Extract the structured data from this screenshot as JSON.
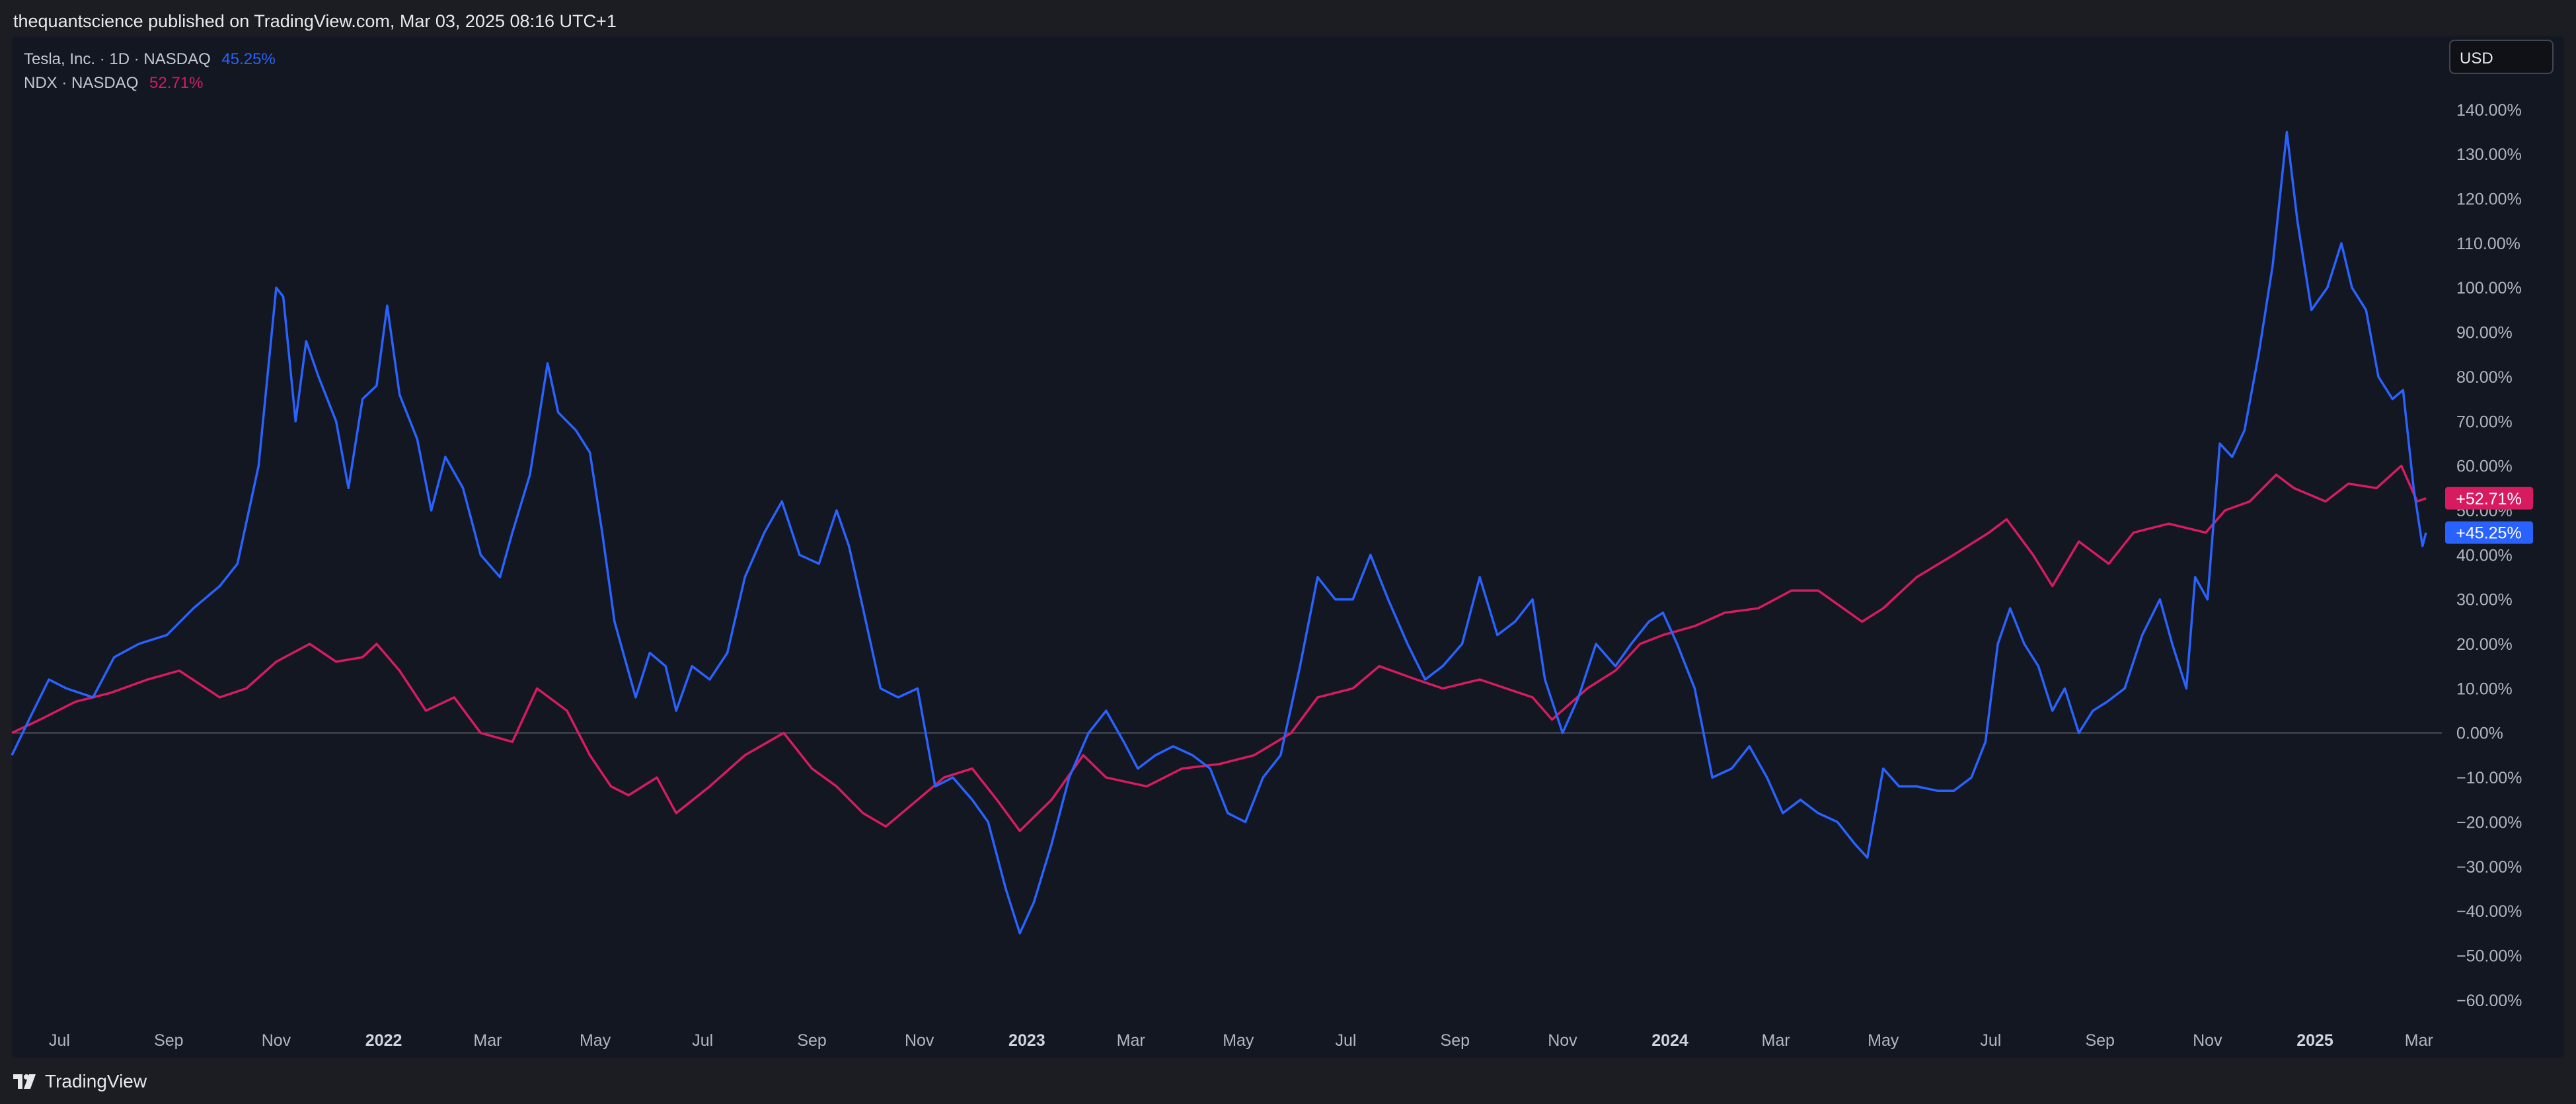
{
  "header": {
    "published": "thequantscience published on TradingView.com, Mar 03, 2025 08:16 UTC+1"
  },
  "legend": [
    {
      "name": "Tesla, Inc. · 1D · NASDAQ",
      "value": "45.25%",
      "color": "#2962ff"
    },
    {
      "name": "NDX · NASDAQ",
      "value": "52.71%",
      "color": "#d81b60"
    }
  ],
  "currency_button": "USD",
  "footer": {
    "brand": "TradingView"
  },
  "chart_data": {
    "type": "line",
    "title": "",
    "xlabel": "",
    "ylabel": "",
    "y_unit": "%",
    "ylim": [
      -67,
      152
    ],
    "xlim": [
      "2021-06-04",
      "2025-03-14"
    ],
    "grid": false,
    "legend_position": "top-left",
    "y_ticks": [
      140,
      130,
      120,
      110,
      100,
      90,
      80,
      70,
      60,
      50,
      40,
      30,
      20,
      10,
      0,
      -10,
      -20,
      -30,
      -40,
      -50,
      -60
    ],
    "y_tick_labels": [
      "140.00%",
      "130.00%",
      "120.00%",
      "110.00%",
      "100.00%",
      "90.00%",
      "80.00%",
      "70.00%",
      "60.00%",
      "50.00%",
      "40.00%",
      "30.00%",
      "20.00%",
      "10.00%",
      "0.00%",
      "−10.00%",
      "−20.00%",
      "−30.00%",
      "−40.00%",
      "−50.00%",
      "−60.00%"
    ],
    "x_ticks": [
      {
        "label": "Jul",
        "date": "2021-07-01",
        "bold": false
      },
      {
        "label": "Sep",
        "date": "2021-09-01",
        "bold": false
      },
      {
        "label": "Nov",
        "date": "2021-11-01",
        "bold": false
      },
      {
        "label": "2022",
        "date": "2022-01-01",
        "bold": true
      },
      {
        "label": "Mar",
        "date": "2022-03-01",
        "bold": false
      },
      {
        "label": "May",
        "date": "2022-05-01",
        "bold": false
      },
      {
        "label": "Jul",
        "date": "2022-07-01",
        "bold": false
      },
      {
        "label": "Sep",
        "date": "2022-09-01",
        "bold": false
      },
      {
        "label": "Nov",
        "date": "2022-11-01",
        "bold": false
      },
      {
        "label": "2023",
        "date": "2023-01-01",
        "bold": true
      },
      {
        "label": "Mar",
        "date": "2023-03-01",
        "bold": false
      },
      {
        "label": "May",
        "date": "2023-05-01",
        "bold": false
      },
      {
        "label": "Jul",
        "date": "2023-07-01",
        "bold": false
      },
      {
        "label": "Sep",
        "date": "2023-09-01",
        "bold": false
      },
      {
        "label": "Nov",
        "date": "2023-11-01",
        "bold": false
      },
      {
        "label": "2024",
        "date": "2024-01-01",
        "bold": true
      },
      {
        "label": "Mar",
        "date": "2024-03-01",
        "bold": false
      },
      {
        "label": "May",
        "date": "2024-05-01",
        "bold": false
      },
      {
        "label": "Jul",
        "date": "2024-07-01",
        "bold": false
      },
      {
        "label": "Sep",
        "date": "2024-09-01",
        "bold": false
      },
      {
        "label": "Nov",
        "date": "2024-11-01",
        "bold": false
      },
      {
        "label": "2025",
        "date": "2025-01-01",
        "bold": true
      },
      {
        "label": "Mar",
        "date": "2025-03-01",
        "bold": false
      }
    ],
    "baseline": 0,
    "series": [
      {
        "name": "Tesla, Inc. · 1D · NASDAQ",
        "color": "#2962ff",
        "last_label": "+45.25%",
        "points": [
          [
            "2021-06-04",
            -5
          ],
          [
            "2021-06-15",
            4
          ],
          [
            "2021-06-25",
            12
          ],
          [
            "2021-07-05",
            10
          ],
          [
            "2021-07-20",
            8
          ],
          [
            "2021-08-01",
            17
          ],
          [
            "2021-08-15",
            20
          ],
          [
            "2021-08-31",
            22
          ],
          [
            "2021-09-15",
            28
          ],
          [
            "2021-09-30",
            33
          ],
          [
            "2021-10-10",
            38
          ],
          [
            "2021-10-22",
            60
          ],
          [
            "2021-11-01",
            100
          ],
          [
            "2021-11-05",
            98
          ],
          [
            "2021-11-12",
            70
          ],
          [
            "2021-11-18",
            88
          ],
          [
            "2021-11-25",
            80
          ],
          [
            "2021-12-05",
            70
          ],
          [
            "2021-12-12",
            55
          ],
          [
            "2021-12-20",
            75
          ],
          [
            "2021-12-28",
            78
          ],
          [
            "2022-01-03",
            96
          ],
          [
            "2022-01-10",
            76
          ],
          [
            "2022-01-20",
            66
          ],
          [
            "2022-01-28",
            50
          ],
          [
            "2022-02-05",
            62
          ],
          [
            "2022-02-15",
            55
          ],
          [
            "2022-02-25",
            40
          ],
          [
            "2022-03-08",
            35
          ],
          [
            "2022-03-15",
            45
          ],
          [
            "2022-03-25",
            58
          ],
          [
            "2022-04-04",
            83
          ],
          [
            "2022-04-10",
            72
          ],
          [
            "2022-04-20",
            68
          ],
          [
            "2022-04-28",
            63
          ],
          [
            "2022-05-05",
            45
          ],
          [
            "2022-05-12",
            25
          ],
          [
            "2022-05-24",
            8
          ],
          [
            "2022-06-01",
            18
          ],
          [
            "2022-06-10",
            15
          ],
          [
            "2022-06-16",
            5
          ],
          [
            "2022-06-25",
            15
          ],
          [
            "2022-07-05",
            12
          ],
          [
            "2022-07-15",
            18
          ],
          [
            "2022-07-25",
            35
          ],
          [
            "2022-08-05",
            45
          ],
          [
            "2022-08-15",
            52
          ],
          [
            "2022-08-25",
            40
          ],
          [
            "2022-09-05",
            38
          ],
          [
            "2022-09-15",
            50
          ],
          [
            "2022-09-22",
            42
          ],
          [
            "2022-09-30",
            28
          ],
          [
            "2022-10-10",
            10
          ],
          [
            "2022-10-20",
            8
          ],
          [
            "2022-10-31",
            10
          ],
          [
            "2022-11-10",
            -12
          ],
          [
            "2022-11-20",
            -10
          ],
          [
            "2022-12-01",
            -15
          ],
          [
            "2022-12-10",
            -20
          ],
          [
            "2022-12-20",
            -35
          ],
          [
            "2022-12-28",
            -45
          ],
          [
            "2023-01-05",
            -38
          ],
          [
            "2023-01-15",
            -25
          ],
          [
            "2023-01-25",
            -10
          ],
          [
            "2023-02-05",
            0
          ],
          [
            "2023-02-15",
            5
          ],
          [
            "2023-02-25",
            -2
          ],
          [
            "2023-03-05",
            -8
          ],
          [
            "2023-03-15",
            -5
          ],
          [
            "2023-03-25",
            -3
          ],
          [
            "2023-04-05",
            -5
          ],
          [
            "2023-04-15",
            -8
          ],
          [
            "2023-04-25",
            -18
          ],
          [
            "2023-05-05",
            -20
          ],
          [
            "2023-05-15",
            -10
          ],
          [
            "2023-05-25",
            -5
          ],
          [
            "2023-06-05",
            15
          ],
          [
            "2023-06-15",
            35
          ],
          [
            "2023-06-25",
            30
          ],
          [
            "2023-07-05",
            30
          ],
          [
            "2023-07-15",
            40
          ],
          [
            "2023-07-25",
            30
          ],
          [
            "2023-08-05",
            20
          ],
          [
            "2023-08-15",
            12
          ],
          [
            "2023-08-25",
            15
          ],
          [
            "2023-09-05",
            20
          ],
          [
            "2023-09-15",
            35
          ],
          [
            "2023-09-25",
            22
          ],
          [
            "2023-10-05",
            25
          ],
          [
            "2023-10-15",
            30
          ],
          [
            "2023-10-22",
            12
          ],
          [
            "2023-11-01",
            0
          ],
          [
            "2023-11-10",
            8
          ],
          [
            "2023-11-20",
            20
          ],
          [
            "2023-12-01",
            15
          ],
          [
            "2023-12-10",
            20
          ],
          [
            "2023-12-20",
            25
          ],
          [
            "2023-12-28",
            27
          ],
          [
            "2024-01-05",
            20
          ],
          [
            "2024-01-15",
            10
          ],
          [
            "2024-01-25",
            -10
          ],
          [
            "2024-02-05",
            -8
          ],
          [
            "2024-02-15",
            -3
          ],
          [
            "2024-02-25",
            -10
          ],
          [
            "2024-03-05",
            -18
          ],
          [
            "2024-03-15",
            -15
          ],
          [
            "2024-03-25",
            -18
          ],
          [
            "2024-04-05",
            -20
          ],
          [
            "2024-04-15",
            -25
          ],
          [
            "2024-04-22",
            -28
          ],
          [
            "2024-05-01",
            -8
          ],
          [
            "2024-05-10",
            -12
          ],
          [
            "2024-05-20",
            -12
          ],
          [
            "2024-06-01",
            -13
          ],
          [
            "2024-06-10",
            -13
          ],
          [
            "2024-06-20",
            -10
          ],
          [
            "2024-06-28",
            -2
          ],
          [
            "2024-07-05",
            20
          ],
          [
            "2024-07-12",
            28
          ],
          [
            "2024-07-20",
            20
          ],
          [
            "2024-07-28",
            15
          ],
          [
            "2024-08-05",
            5
          ],
          [
            "2024-08-12",
            10
          ],
          [
            "2024-08-20",
            0
          ],
          [
            "2024-08-28",
            5
          ],
          [
            "2024-09-05",
            7
          ],
          [
            "2024-09-15",
            10
          ],
          [
            "2024-09-25",
            22
          ],
          [
            "2024-10-05",
            30
          ],
          [
            "2024-10-12",
            20
          ],
          [
            "2024-10-20",
            10
          ],
          [
            "2024-10-25",
            35
          ],
          [
            "2024-11-01",
            30
          ],
          [
            "2024-11-08",
            65
          ],
          [
            "2024-11-15",
            62
          ],
          [
            "2024-11-22",
            68
          ],
          [
            "2024-11-30",
            85
          ],
          [
            "2024-12-08",
            105
          ],
          [
            "2024-12-16",
            135
          ],
          [
            "2024-12-22",
            115
          ],
          [
            "2024-12-30",
            95
          ],
          [
            "2025-01-08",
            100
          ],
          [
            "2025-01-16",
            110
          ],
          [
            "2025-01-22",
            100
          ],
          [
            "2025-01-30",
            95
          ],
          [
            "2025-02-06",
            80
          ],
          [
            "2025-02-14",
            75
          ],
          [
            "2025-02-20",
            77
          ],
          [
            "2025-02-26",
            55
          ],
          [
            "2025-03-03",
            42
          ],
          [
            "2025-03-05",
            45
          ]
        ]
      },
      {
        "name": "NDX · NASDAQ",
        "color": "#d81b60",
        "last_label": "+52.71%",
        "points": [
          [
            "2021-06-04",
            0
          ],
          [
            "2021-06-20",
            3
          ],
          [
            "2021-07-10",
            7
          ],
          [
            "2021-07-30",
            9
          ],
          [
            "2021-08-20",
            12
          ],
          [
            "2021-09-07",
            14
          ],
          [
            "2021-09-30",
            8
          ],
          [
            "2021-10-15",
            10
          ],
          [
            "2021-11-01",
            16
          ],
          [
            "2021-11-20",
            20
          ],
          [
            "2021-12-05",
            16
          ],
          [
            "2021-12-20",
            17
          ],
          [
            "2021-12-28",
            20
          ],
          [
            "2022-01-10",
            14
          ],
          [
            "2022-01-25",
            5
          ],
          [
            "2022-02-10",
            8
          ],
          [
            "2022-02-25",
            0
          ],
          [
            "2022-03-15",
            -2
          ],
          [
            "2022-03-29",
            10
          ],
          [
            "2022-04-15",
            5
          ],
          [
            "2022-04-28",
            -5
          ],
          [
            "2022-05-10",
            -12
          ],
          [
            "2022-05-20",
            -14
          ],
          [
            "2022-06-05",
            -10
          ],
          [
            "2022-06-16",
            -18
          ],
          [
            "2022-07-05",
            -12
          ],
          [
            "2022-07-25",
            -5
          ],
          [
            "2022-08-16",
            0
          ],
          [
            "2022-09-01",
            -8
          ],
          [
            "2022-09-15",
            -12
          ],
          [
            "2022-09-30",
            -18
          ],
          [
            "2022-10-13",
            -21
          ],
          [
            "2022-10-31",
            -15
          ],
          [
            "2022-11-15",
            -10
          ],
          [
            "2022-12-01",
            -8
          ],
          [
            "2022-12-15",
            -15
          ],
          [
            "2022-12-28",
            -22
          ],
          [
            "2023-01-15",
            -15
          ],
          [
            "2023-02-02",
            -5
          ],
          [
            "2023-02-15",
            -10
          ],
          [
            "2023-03-10",
            -12
          ],
          [
            "2023-03-30",
            -8
          ],
          [
            "2023-04-20",
            -7
          ],
          [
            "2023-05-10",
            -5
          ],
          [
            "2023-05-31",
            0
          ],
          [
            "2023-06-15",
            8
          ],
          [
            "2023-07-05",
            10
          ],
          [
            "2023-07-20",
            15
          ],
          [
            "2023-08-10",
            12
          ],
          [
            "2023-08-25",
            10
          ],
          [
            "2023-09-15",
            12
          ],
          [
            "2023-09-30",
            10
          ],
          [
            "2023-10-15",
            8
          ],
          [
            "2023-10-26",
            3
          ],
          [
            "2023-11-15",
            10
          ],
          [
            "2023-12-01",
            14
          ],
          [
            "2023-12-15",
            20
          ],
          [
            "2023-12-28",
            22
          ],
          [
            "2024-01-15",
            24
          ],
          [
            "2024-02-01",
            27
          ],
          [
            "2024-02-20",
            28
          ],
          [
            "2024-03-10",
            32
          ],
          [
            "2024-03-25",
            32
          ],
          [
            "2024-04-19",
            25
          ],
          [
            "2024-05-01",
            28
          ],
          [
            "2024-05-20",
            35
          ],
          [
            "2024-06-10",
            40
          ],
          [
            "2024-06-30",
            45
          ],
          [
            "2024-07-10",
            48
          ],
          [
            "2024-07-25",
            40
          ],
          [
            "2024-08-05",
            33
          ],
          [
            "2024-08-20",
            43
          ],
          [
            "2024-09-06",
            38
          ],
          [
            "2024-09-20",
            45
          ],
          [
            "2024-10-10",
            47
          ],
          [
            "2024-10-31",
            45
          ],
          [
            "2024-11-11",
            50
          ],
          [
            "2024-11-25",
            52
          ],
          [
            "2024-12-10",
            58
          ],
          [
            "2024-12-20",
            55
          ],
          [
            "2025-01-07",
            52
          ],
          [
            "2025-01-20",
            56
          ],
          [
            "2025-02-05",
            55
          ],
          [
            "2025-02-19",
            60
          ],
          [
            "2025-02-28",
            52
          ],
          [
            "2025-03-05",
            52.7
          ]
        ]
      }
    ]
  }
}
